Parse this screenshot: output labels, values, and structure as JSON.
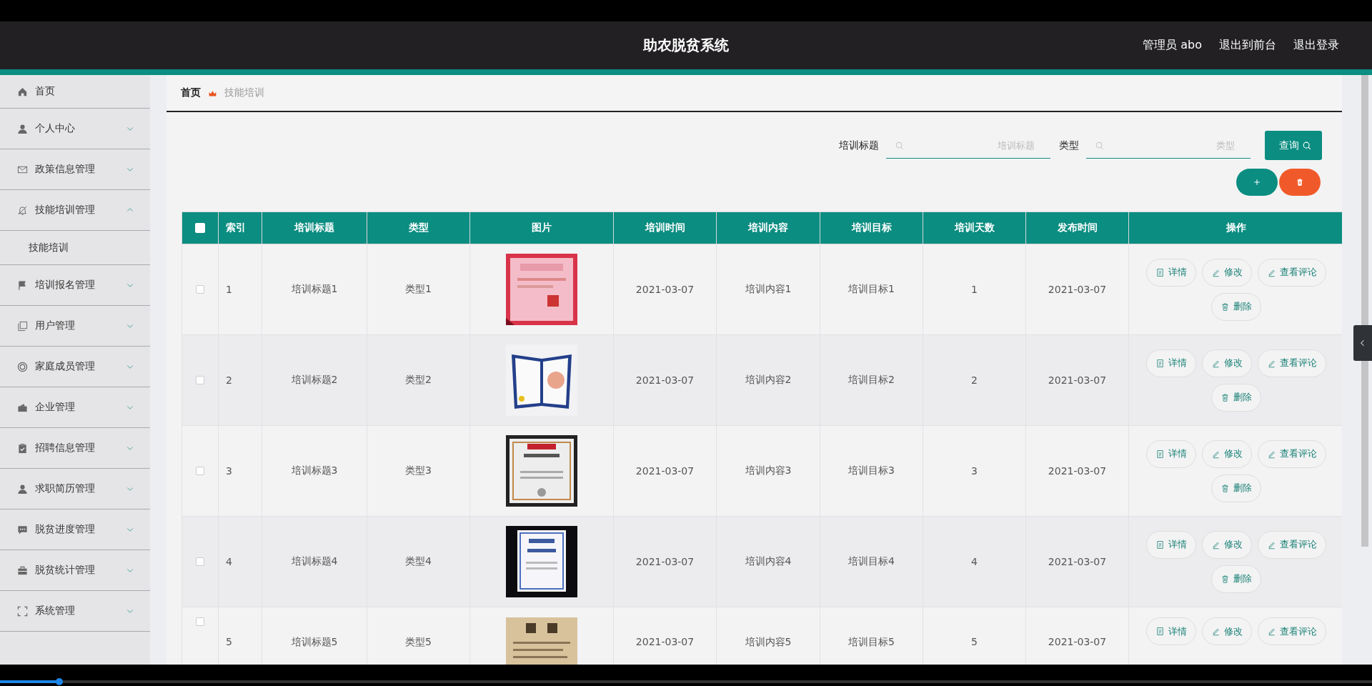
{
  "header": {
    "title": "助农脱贫系统",
    "links": [
      "管理员 abo",
      "退出到前台",
      "退出登录"
    ]
  },
  "sidebar": {
    "items": [
      {
        "label": "首页"
      },
      {
        "label": "个人中心",
        "expanded": false
      },
      {
        "label": "政策信息管理",
        "expanded": false
      },
      {
        "label": "技能培训管理",
        "expanded": true,
        "children": [
          {
            "label": "技能培训"
          }
        ]
      },
      {
        "label": "培训报名管理",
        "expanded": false
      },
      {
        "label": "用户管理",
        "expanded": false
      },
      {
        "label": "家庭成员管理",
        "expanded": false
      },
      {
        "label": "企业管理",
        "expanded": false
      },
      {
        "label": "招聘信息管理",
        "expanded": false
      },
      {
        "label": "求职简历管理",
        "expanded": false
      },
      {
        "label": "脱贫进度管理",
        "expanded": false
      },
      {
        "label": "脱贫统计管理",
        "expanded": false
      },
      {
        "label": "系统管理",
        "expanded": false
      }
    ]
  },
  "breadcrumb": [
    "首页",
    "技能培训"
  ],
  "search": {
    "fields": [
      {
        "label": "培训标题",
        "placeholder": "培训标题"
      },
      {
        "label": "类型",
        "placeholder": "类型"
      }
    ],
    "button": "查询"
  },
  "table": {
    "select_all": {
      "checked": false
    },
    "columns": [
      "索引",
      "培训标题",
      "类型",
      "图片",
      "培训时间",
      "培训内容",
      "培训目标",
      "培训天数",
      "发布时间",
      "操作"
    ],
    "rows": [
      {
        "checked": false,
        "cells": [
          "1",
          "培训标题1",
          "类型1",
          {
            "kind": "picture"
          },
          "2021-03-07",
          "培训内容1",
          "培训目标1",
          "1",
          "2021-03-07"
        ],
        "actions": [
          {
            "kind": "detail",
            "label": "详情"
          },
          {
            "kind": "edit",
            "label": "修改"
          },
          {
            "kind": "edit",
            "label": "查看评论"
          },
          {
            "kind": "delete",
            "label": "删除"
          }
        ]
      },
      {
        "checked": false,
        "cells": [
          "2",
          "培训标题2",
          "类型2",
          {
            "kind": "picture"
          },
          "2021-03-07",
          "培训内容2",
          "培训目标2",
          "2",
          "2021-03-07"
        ],
        "actions": [
          {
            "kind": "detail",
            "label": "详情"
          },
          {
            "kind": "edit",
            "label": "修改"
          },
          {
            "kind": "edit",
            "label": "查看评论"
          },
          {
            "kind": "delete",
            "label": "删除"
          }
        ]
      },
      {
        "checked": false,
        "cells": [
          "3",
          "培训标题3",
          "类型3",
          {
            "kind": "picture"
          },
          "2021-03-07",
          "培训内容3",
          "培训目标3",
          "3",
          "2021-03-07"
        ],
        "actions": [
          {
            "kind": "detail",
            "label": "详情"
          },
          {
            "kind": "edit",
            "label": "修改"
          },
          {
            "kind": "edit",
            "label": "查看评论"
          },
          {
            "kind": "delete",
            "label": "删除"
          }
        ]
      },
      {
        "checked": false,
        "cells": [
          "4",
          "培训标题4",
          "类型4",
          {
            "kind": "picture"
          },
          "2021-03-07",
          "培训内容4",
          "培训目标4",
          "4",
          "2021-03-07"
        ],
        "actions": [
          {
            "kind": "detail",
            "label": "详情"
          },
          {
            "kind": "edit",
            "label": "修改"
          },
          {
            "kind": "edit",
            "label": "查看评论"
          },
          {
            "kind": "delete",
            "label": "删除"
          }
        ]
      },
      {
        "checked": false,
        "cells": [
          "5",
          "培训标题5",
          "类型5",
          {
            "kind": "picture"
          },
          "2021-03-07",
          "培训内容5",
          "培训目标5",
          "5",
          "2021-03-07"
        ],
        "actions": [
          {
            "kind": "detail",
            "label": "详情"
          },
          {
            "kind": "edit",
            "label": "修改"
          },
          {
            "kind": "edit",
            "label": "查看评论"
          }
        ]
      }
    ]
  },
  "video_bar": {
    "level": 0.043
  }
}
